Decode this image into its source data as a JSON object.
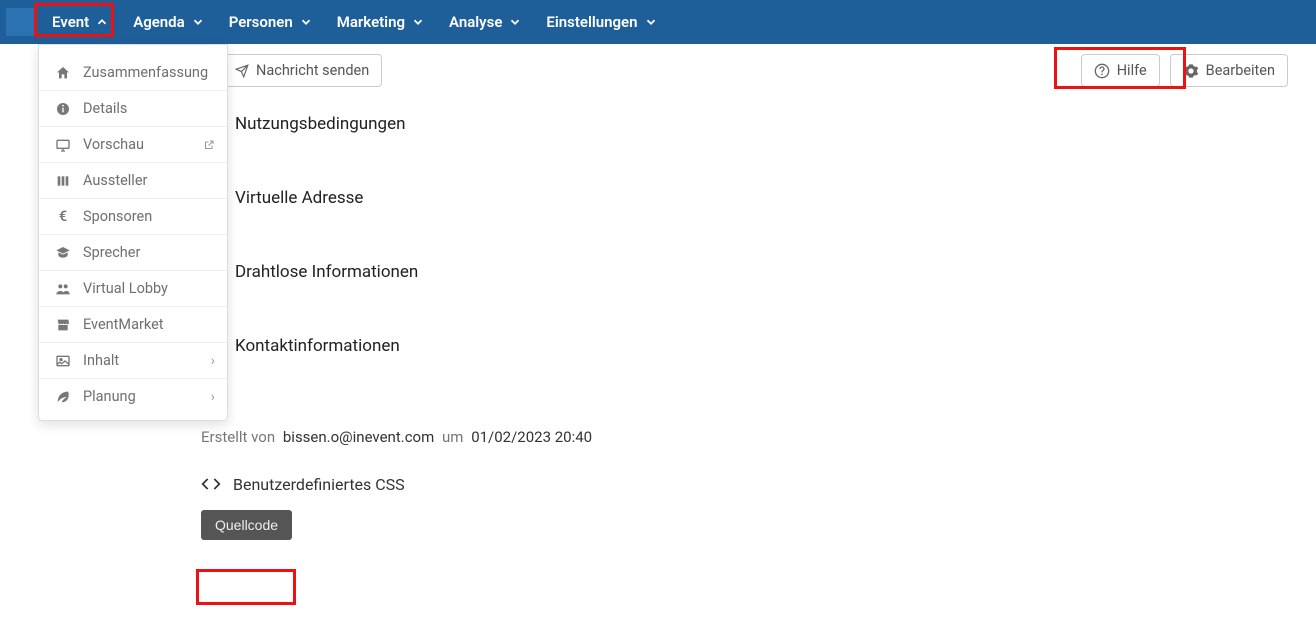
{
  "nav": {
    "items": [
      {
        "label": "Event"
      },
      {
        "label": "Agenda"
      },
      {
        "label": "Personen"
      },
      {
        "label": "Marketing"
      },
      {
        "label": "Analyse"
      },
      {
        "label": "Einstellungen"
      }
    ]
  },
  "dropdown": {
    "items": [
      {
        "label": "Zusammenfassung"
      },
      {
        "label": "Details"
      },
      {
        "label": "Vorschau"
      },
      {
        "label": "Aussteller"
      },
      {
        "label": "Sponsoren"
      },
      {
        "label": "Sprecher"
      },
      {
        "label": "Virtual Lobby"
      },
      {
        "label": "EventMarket"
      },
      {
        "label": "Inhalt"
      },
      {
        "label": "Planung"
      }
    ]
  },
  "toolbar": {
    "send": "Nachricht senden",
    "help": "Hilfe",
    "edit": "Bearbeiten"
  },
  "sections": {
    "terms": "Nutzungsbedingungen",
    "virtual": "Virtuelle Adresse",
    "wireless": "Drahtlose Informationen",
    "contact": "Kontaktinformationen"
  },
  "contact_empty": "( )",
  "created": {
    "prefix": "Erstellt von",
    "email": "bissen.o@inevent.com",
    "mid": "um",
    "date": "01/02/2023 20:40"
  },
  "css_label": "Benutzerdefiniertes CSS",
  "source_btn": "Quellcode"
}
